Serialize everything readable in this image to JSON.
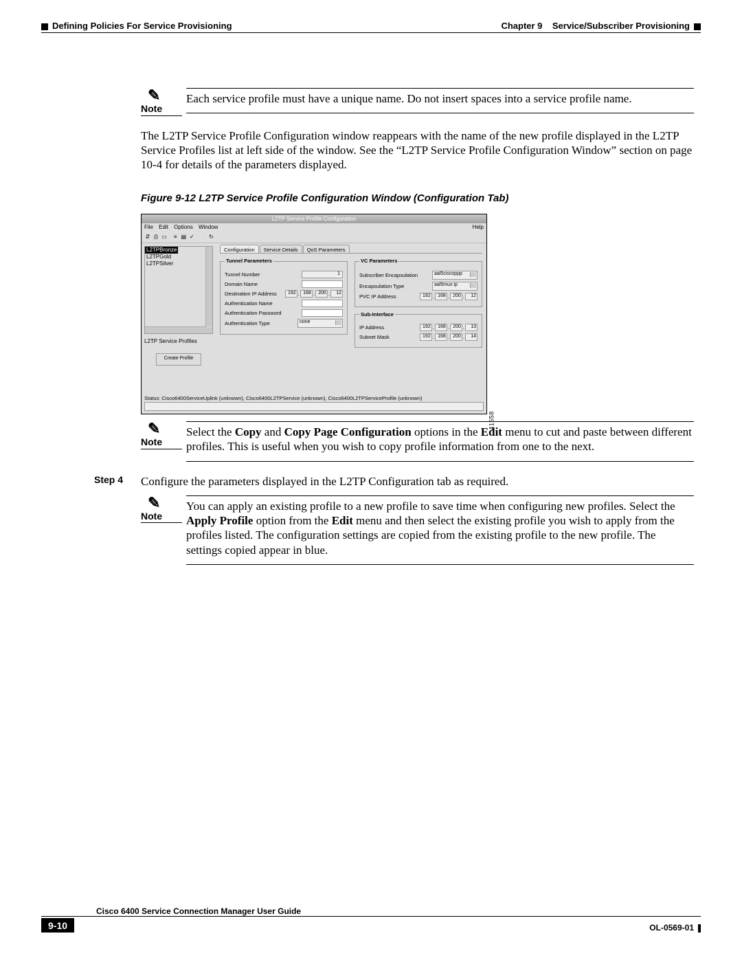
{
  "header": {
    "left": "Defining Policies For Service Provisioning",
    "right_chapter": "Chapter 9",
    "right_title": "Service/Subscriber Provisioning"
  },
  "note1": {
    "label": "Note",
    "text": "Each service profile must have a unique name. Do not insert spaces into a service profile name."
  },
  "para1": "The L2TP Service Profile Configuration window reappears with the name of the new profile displayed in the L2TP Service Profiles list at left side of the window. See the “L2TP Service Profile Configuration Window” section on page 10-4 for details of the parameters displayed.",
  "figcaption": "Figure 9-12   L2TP Service Profile Configuration Window (Configuration Tab)",
  "screenshot": {
    "title": "L2TP Service Profile Configuration",
    "menu": {
      "file": "File",
      "edit": "Edit",
      "options": "Options",
      "window": "Window",
      "help": "Help"
    },
    "profiles": {
      "sel": "L2TPBronze",
      "items": [
        "L2TPGold",
        "L2TPSilver"
      ],
      "label": "L2TP Service Profiles",
      "create": "Create Profile"
    },
    "tabs": {
      "a": "Configuration",
      "b": "Service Details",
      "c": "QoS Parameters"
    },
    "tunnel": {
      "legend": "Tunnel Parameters",
      "number_lbl": "Tunnel Number",
      "number_val": "1",
      "domain_lbl": "Domain Name",
      "dest_lbl": "Destination IP Address",
      "dest_ip": [
        "192",
        "168",
        "200",
        "12"
      ],
      "authn_lbl": "Authentication Name",
      "authp_lbl": "Authentication Password",
      "autht_lbl": "Authentication Type",
      "autht_val": "none"
    },
    "vc": {
      "legend": "VC Parameters",
      "sub_lbl": "Subscriber Encapsulation",
      "sub_val": "aal5ciscoppp",
      "enc_lbl": "Encapsulation Type",
      "enc_val": "aal5mux ip",
      "pvc_lbl": "PVC IP Address",
      "pvc_ip": [
        "192",
        "168",
        "200",
        "12"
      ]
    },
    "sub": {
      "legend": "Sub-Interface",
      "ip_lbl": "IP Address",
      "ip": [
        "192",
        "168",
        "200",
        "13"
      ],
      "mask_lbl": "Subnet Mask",
      "mask": [
        "192",
        "168",
        "200",
        "14"
      ]
    },
    "status": "Status: Cisco6400ServiceUplink (unknown), Cisco6400L2TPService (unknown), Cisco6400L2TPServiceProfile (unknown)",
    "fig_id": "41558"
  },
  "note2": {
    "label": "Note",
    "pre": "Select the ",
    "b1": "Copy",
    "mid1": " and ",
    "b2": "Copy Page Configuration",
    "mid2": " options in the ",
    "b3": "Edit",
    "post": " menu to cut and paste between different profiles. This is useful when you wish to copy profile information from one to the next."
  },
  "step4": {
    "label": "Step 4",
    "text": "Configure the parameters displayed in the L2TP Configuration tab as required."
  },
  "note3": {
    "label": "Note",
    "pre": "You can apply an existing profile to a new profile to save time when configuring new profiles. Select the ",
    "b1": "Apply Profile",
    "mid1": " option from the ",
    "b2": "Edit",
    "post": " menu and then select the existing profile you wish to apply from the profiles listed. The configuration settings are copied from the existing profile to the new profile. The settings copied appear in blue."
  },
  "footer": {
    "guide": "Cisco 6400 Service Connection Manager User Guide",
    "pagenum": "9-10",
    "doc": "OL-0569-01"
  }
}
